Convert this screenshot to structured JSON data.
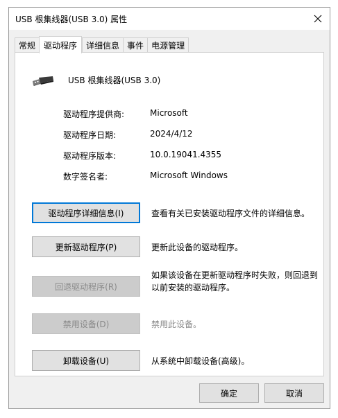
{
  "window": {
    "title": "USB 根集线器(USB 3.0) 属性"
  },
  "tabs": [
    {
      "label": "常规",
      "active": false
    },
    {
      "label": "驱动程序",
      "active": true
    },
    {
      "label": "详细信息",
      "active": false
    },
    {
      "label": "事件",
      "active": false
    },
    {
      "label": "电源管理",
      "active": false
    }
  ],
  "device": {
    "name": "USB 根集线器(USB 3.0)",
    "icon": "usb-plug-icon"
  },
  "info": [
    {
      "label": "驱动程序提供商:",
      "value": "Microsoft"
    },
    {
      "label": "驱动程序日期:",
      "value": "2024/4/12"
    },
    {
      "label": "驱动程序版本:",
      "value": "10.0.19041.4355"
    },
    {
      "label": "数字签名者:",
      "value": "Microsoft Windows"
    }
  ],
  "actions": [
    {
      "label": "驱动程序详细信息(I)",
      "desc": "查看有关已安装驱动程序文件的详细信息。",
      "enabled": true,
      "focused": true
    },
    {
      "label": "更新驱动程序(P)",
      "desc": "更新此设备的驱动程序。",
      "enabled": true
    },
    {
      "label": "回退驱动程序(R)",
      "desc": "如果该设备在更新驱动程序时失败，则回退到以前安装的驱动程序。",
      "enabled": false
    },
    {
      "label": "禁用设备(D)",
      "desc": "禁用此设备。",
      "enabled": false
    },
    {
      "label": "卸载设备(U)",
      "desc": "从系统中卸载设备(高级)。",
      "enabled": true
    }
  ],
  "footer": {
    "ok_label": "确定",
    "cancel_label": "取消"
  },
  "colors": {
    "focus": "#0078d7",
    "disabled_text": "#8a8a8a",
    "button_bg": "#e1e1e1"
  }
}
